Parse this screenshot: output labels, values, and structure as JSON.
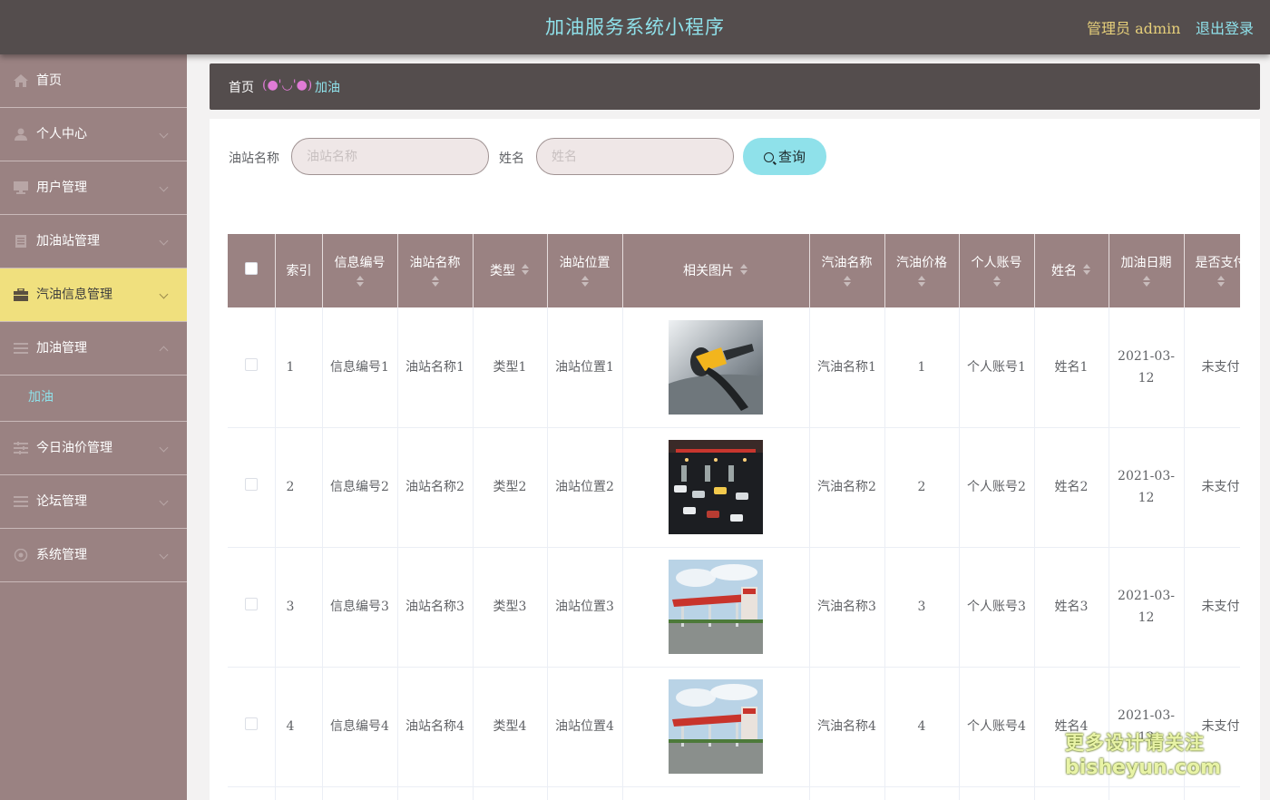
{
  "header": {
    "title": "加油服务系统小程序",
    "admin": "管理员 admin",
    "logout": "退出登录"
  },
  "sidebar": {
    "items": [
      {
        "label": "首页",
        "icon": "home-icon"
      },
      {
        "label": "个人中心",
        "icon": "user-icon"
      },
      {
        "label": "用户管理",
        "icon": "monitor-icon"
      },
      {
        "label": "加油站管理",
        "icon": "document-icon"
      },
      {
        "label": "汽油信息管理",
        "icon": "briefcase-icon"
      },
      {
        "label": "加油管理",
        "icon": "list-icon"
      },
      {
        "label": "今日油价管理",
        "icon": "sliders-icon"
      },
      {
        "label": "论坛管理",
        "icon": "list-icon"
      },
      {
        "label": "系统管理",
        "icon": "settings-icon"
      }
    ],
    "subitem": "加油"
  },
  "breadcrumb": {
    "home": "首页",
    "sep": "(●'◡'●)",
    "current": "加油"
  },
  "search": {
    "station_label": "油站名称",
    "station_placeholder": "油站名称",
    "name_label": "姓名",
    "name_placeholder": "姓名",
    "query": "查询"
  },
  "table": {
    "headers": [
      "索引",
      "信息编号",
      "油站名称",
      "类型",
      "油站位置",
      "相关图片",
      "汽油名称",
      "汽油价格",
      "个人账号",
      "姓名",
      "加油日期",
      "是否支付"
    ],
    "rows": [
      {
        "index": "1",
        "info_no": "信息编号1",
        "station": "油站名称1",
        "type": "类型1",
        "location": "油站位置1",
        "image": "fuel-nozzle-photo",
        "gas": "汽油名称1",
        "price": "1",
        "account": "个人账号1",
        "name": "姓名1",
        "date": "2021-03-12",
        "paid": "未支付"
      },
      {
        "index": "2",
        "info_no": "信息编号2",
        "station": "油站名称2",
        "type": "类型2",
        "location": "油站位置2",
        "image": "night-station-photo",
        "gas": "汽油名称2",
        "price": "2",
        "account": "个人账号2",
        "name": "姓名2",
        "date": "2021-03-12",
        "paid": "未支付"
      },
      {
        "index": "3",
        "info_no": "信息编号3",
        "station": "油站名称3",
        "type": "类型3",
        "location": "油站位置3",
        "image": "station-exterior-photo",
        "gas": "汽油名称3",
        "price": "3",
        "account": "个人账号3",
        "name": "姓名3",
        "date": "2021-03-12",
        "paid": "未支付"
      },
      {
        "index": "4",
        "info_no": "信息编号4",
        "station": "油站名称4",
        "type": "类型4",
        "location": "油站位置4",
        "image": "station-exterior-photo",
        "gas": "汽油名称4",
        "price": "4",
        "account": "个人账号4",
        "name": "姓名4",
        "date": "2021-03-12",
        "paid": "未支付"
      }
    ]
  },
  "watermark": {
    "line1": "更多设计请关注",
    "line2": "bisheyun.com"
  },
  "colors": {
    "header_bg": "#544d4d",
    "sidebar_bg": "#9a8282",
    "accent_cyan": "#8fe1ea",
    "active_yellow": "#f0e07e",
    "admin_gold": "#e6cf7a"
  }
}
